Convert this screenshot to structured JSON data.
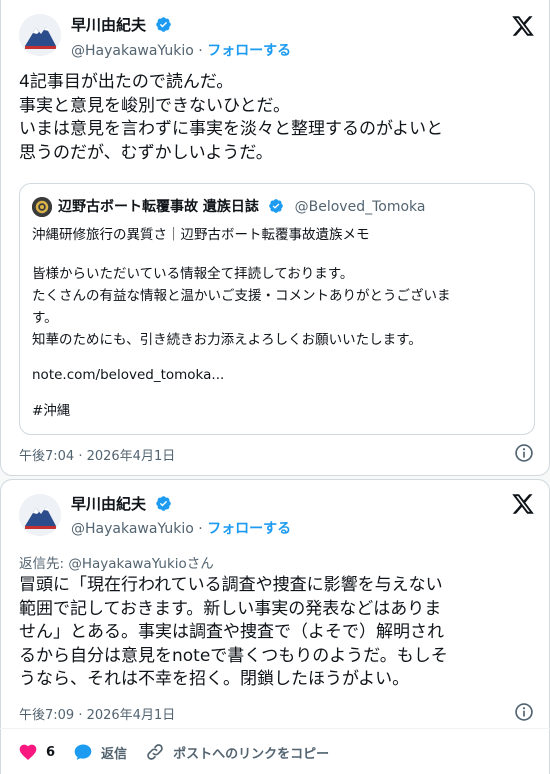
{
  "tweet1": {
    "name": "早川由紀夫",
    "handle": "@HayakawaYukio",
    "separator": "·",
    "follow_label": "フォローする",
    "text_lines": [
      "4記事目が出たので読んだ。",
      "事実と意見を峻別できないひとだ。",
      "いまは意見を言わずに事実を淡々と整理するのがよいと",
      "思うのだが、むずかしいようだ。"
    ],
    "timestamp": "午後7:04 · 2026年4月1日",
    "quote": {
      "name": "辺野古ボート転覆事故 遺族日誌",
      "handle": "@Beloved_Tomoka",
      "title": "沖縄研修旅行の異質さ｜辺野古ボート転覆事故遺族メモ",
      "body": "皆様からいただいている情報全て拝読しております。\nたくさんの有益な情報と温かいご支援・コメントありがとうございま\nす。\n知華のためにも、引き続きお力添えよろしくお願いいたします。",
      "link": "note.com/beloved_tomoka...",
      "hashtag": "#沖縄"
    }
  },
  "tweet2": {
    "name": "早川由紀夫",
    "handle": "@HayakawaYukio",
    "separator": "·",
    "follow_label": "フォローする",
    "reply_to": "返信先: @HayakawaYukioさん",
    "text_lines": [
      "冒頭に「現在行われている調査や捜査に影響を与えない",
      "範囲で記しておきます。新しい事実の発表などはありま",
      "せん」とある。事実は調査や捜査で（よそで）解明され",
      "るから自分は意見をnoteで書くつもりのようだ。もしそ",
      "うなら、それは不幸を招く。閉鎖したほうがよい。"
    ],
    "timestamp": "午後7:09 · 2026年4月1日",
    "like_count": "6",
    "reply_label": "返信",
    "copy_link_label": "ポストへのリンクをコピー"
  },
  "colors": {
    "accent": "#1d9bf0",
    "like": "#f91880",
    "muted": "#536471"
  },
  "icons": [
    "verified-badge-icon",
    "x-logo-icon",
    "info-icon",
    "heart-icon",
    "reply-icon",
    "link-icon"
  ]
}
